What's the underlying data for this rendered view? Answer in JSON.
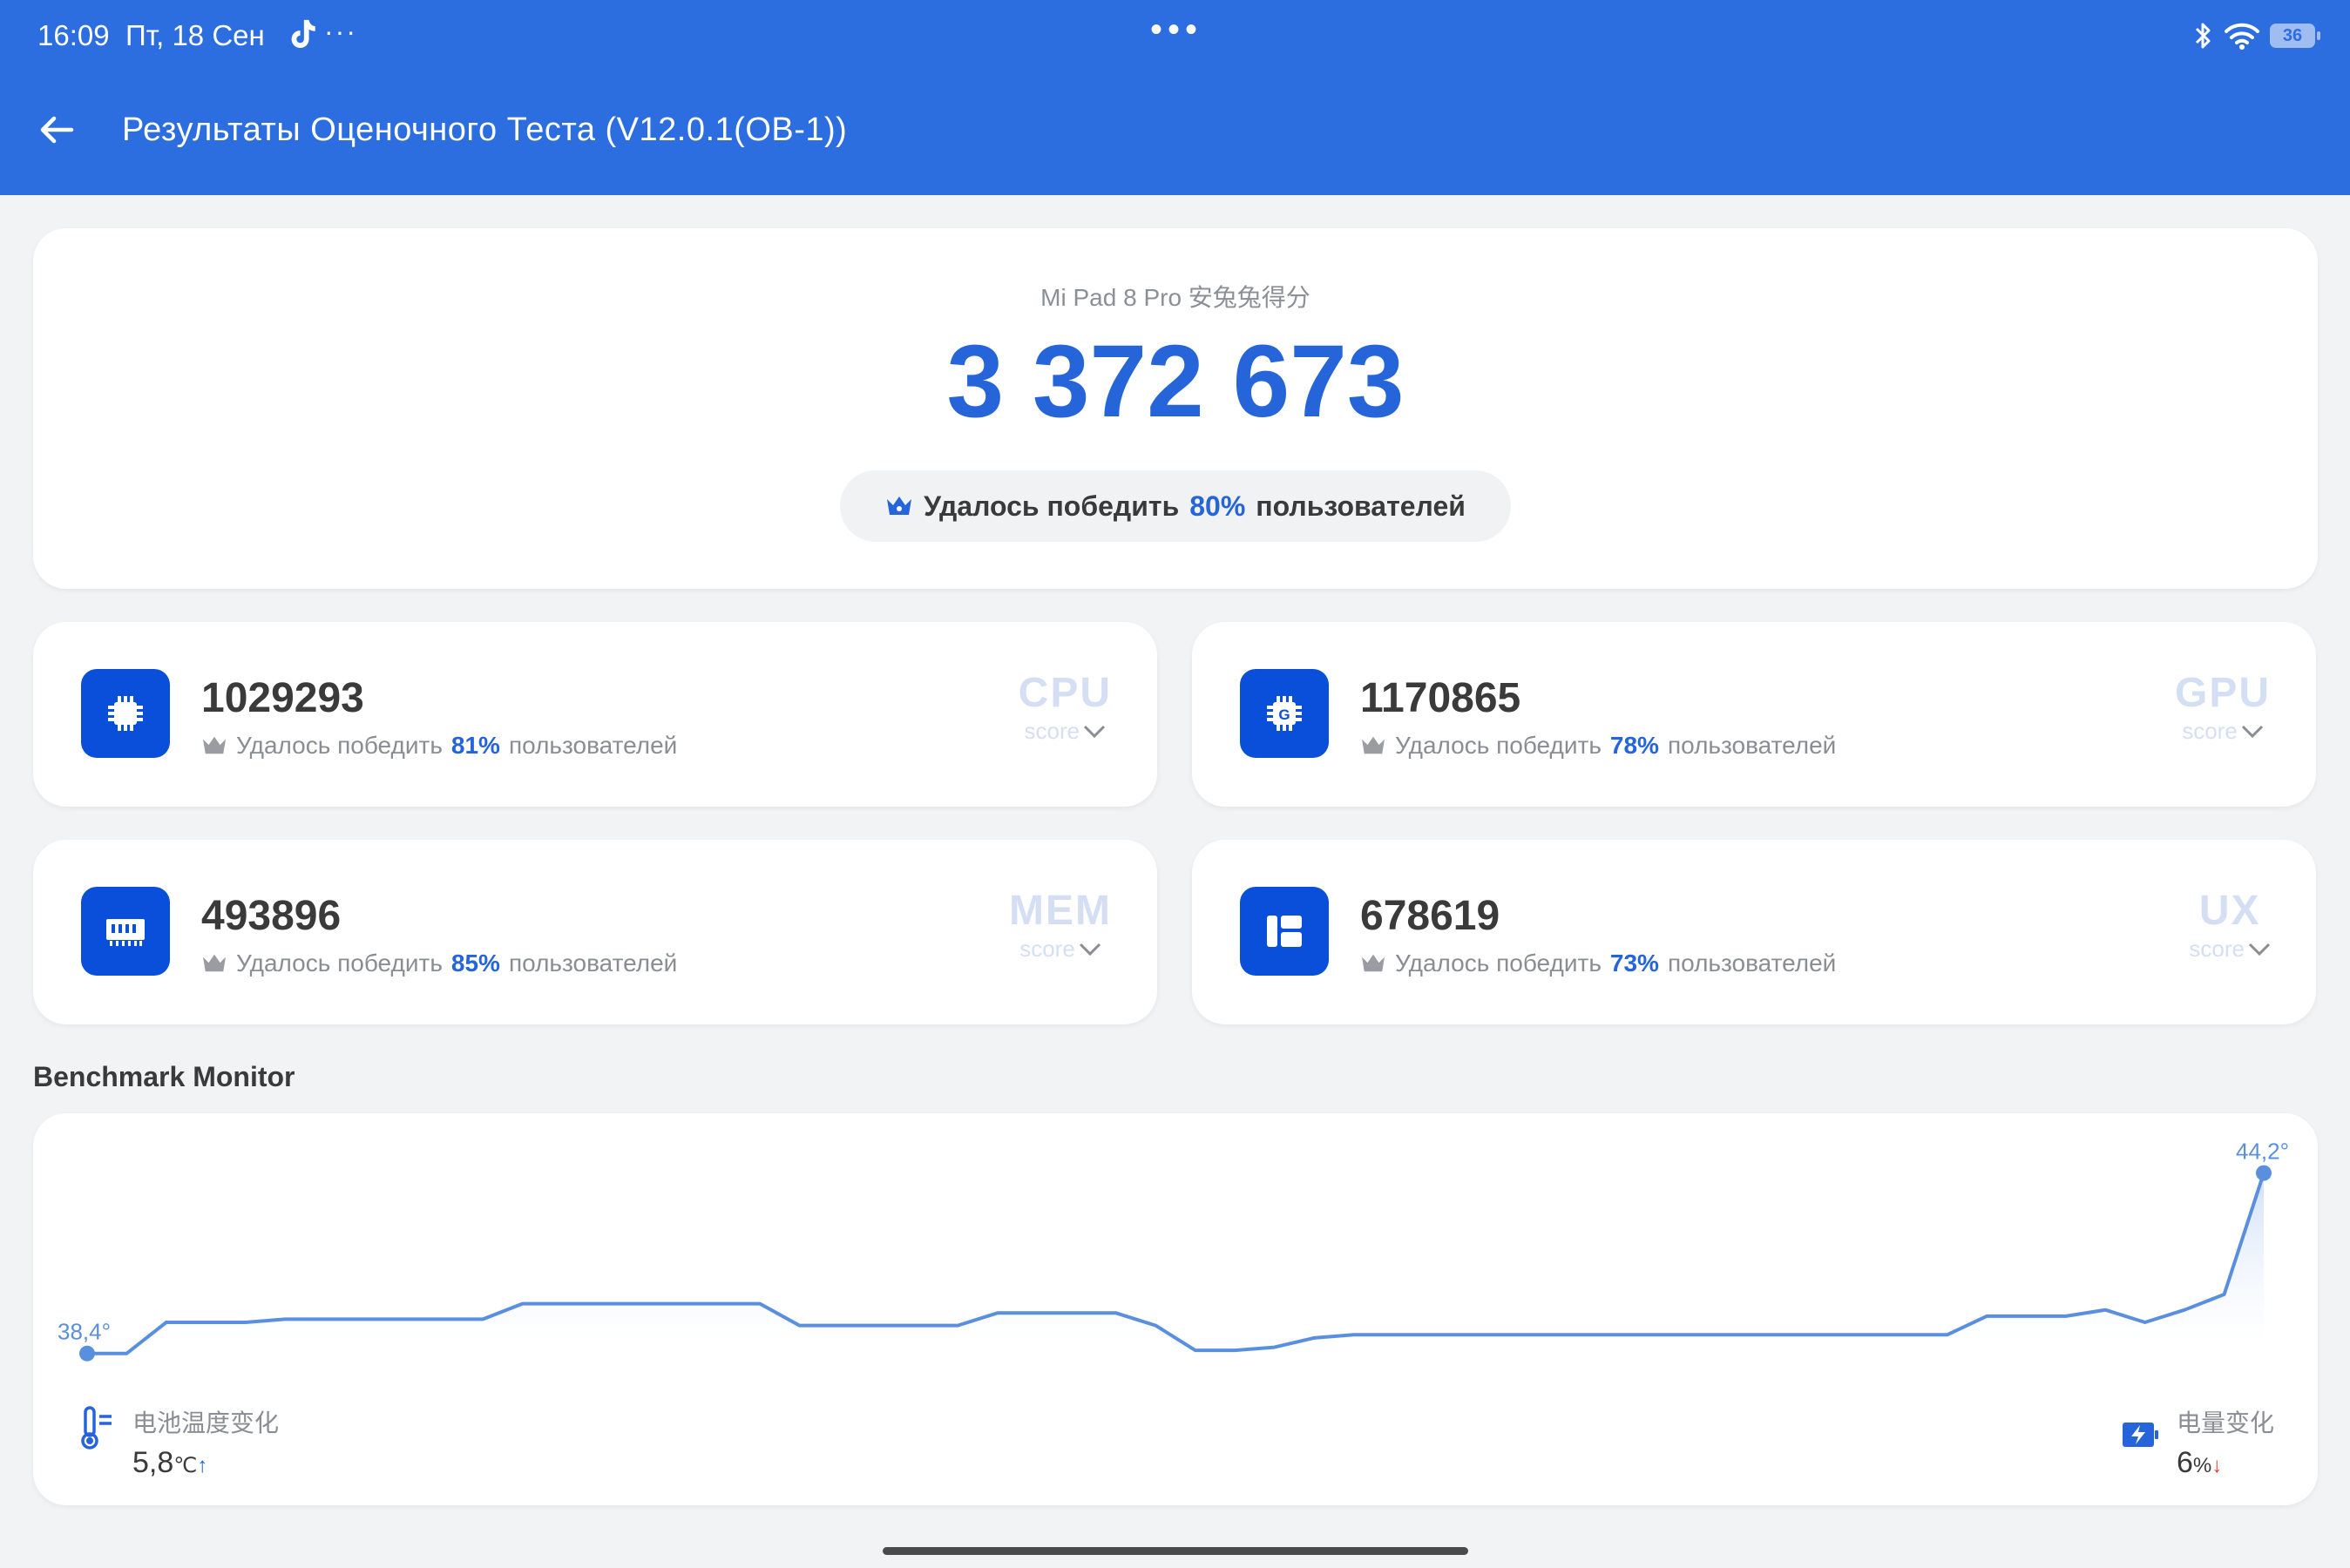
{
  "status_bar": {
    "time": "16:09",
    "date": "Пт, 18 Сен",
    "more": "···",
    "center_dots": "•••",
    "battery_level": "36"
  },
  "header": {
    "title": "Результаты Оценочного Теста (V12.0.1(OB-1))",
    "back_icon": "arrow-left-icon"
  },
  "summary": {
    "device_label": "Mi Pad 8 Pro 安兔兔得分",
    "total_score": "3 372 673",
    "beat_prefix": "Удалось победить",
    "beat_pct": "80%",
    "beat_suffix": "пользователей"
  },
  "scores": [
    {
      "value": "1029293",
      "beat_prefix": "Удалось победить",
      "beat_pct": "81%",
      "beat_suffix": "пользователей",
      "category": "CPU",
      "sub": "score",
      "icon": "cpu-chip-icon"
    },
    {
      "value": "1170865",
      "beat_prefix": "Удалось победить",
      "beat_pct": "78%",
      "beat_suffix": "пользователей",
      "category": "GPU",
      "sub": "score",
      "icon": "gpu-chip-icon"
    },
    {
      "value": "493896",
      "beat_prefix": "Удалось победить",
      "beat_pct": "85%",
      "beat_suffix": "пользователей",
      "category": "MEM",
      "sub": "score",
      "icon": "memory-icon"
    },
    {
      "value": "678619",
      "beat_prefix": "Удалось победить",
      "beat_pct": "73%",
      "beat_suffix": "пользователей",
      "category": "UX",
      "sub": "score",
      "icon": "ux-layout-icon"
    }
  ],
  "monitor": {
    "title": "Benchmark Monitor",
    "start_label": "38,4°",
    "end_label": "44,2°",
    "battery_temp_label": "电池温度变化",
    "battery_temp_value": "5,8",
    "battery_temp_unit": "℃",
    "battery_level_label": "电量变化",
    "battery_level_value": "6",
    "battery_level_unit": "%"
  },
  "chart_data": {
    "type": "area",
    "ylim": [
      38.0,
      45.0
    ],
    "grid": false,
    "y": [
      38.4,
      38.4,
      39.4,
      39.4,
      39.4,
      39.5,
      39.5,
      39.5,
      39.5,
      39.5,
      39.5,
      40.0,
      40.0,
      40.0,
      40.0,
      40.0,
      40.0,
      40.0,
      39.3,
      39.3,
      39.3,
      39.3,
      39.3,
      39.7,
      39.7,
      39.7,
      39.7,
      39.3,
      38.5,
      38.5,
      38.6,
      38.9,
      39.0,
      39.0,
      39.0,
      39.0,
      39.0,
      39.0,
      39.0,
      39.0,
      39.0,
      39.0,
      39.0,
      39.0,
      39.0,
      39.0,
      39.0,
      39.0,
      39.6,
      39.6,
      39.6,
      39.8,
      39.4,
      39.8,
      40.3,
      44.2
    ],
    "colors": {
      "line": "#5a8fe0",
      "fill_top": "#cdddf8"
    }
  }
}
